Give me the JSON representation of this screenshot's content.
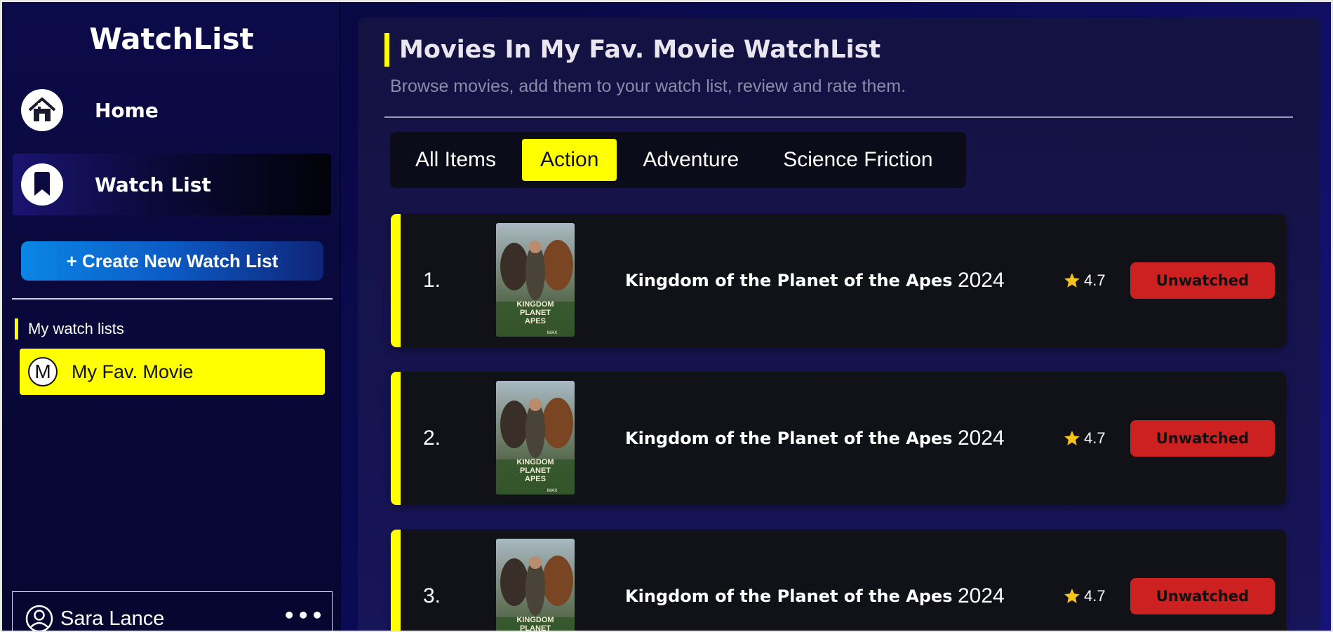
{
  "sidebar": {
    "brand": "WatchList",
    "nav": [
      {
        "label": "Home",
        "icon": "home-icon"
      },
      {
        "label": "Watch List",
        "icon": "bookmark-icon"
      }
    ],
    "create_button": "+ Create New Watch List",
    "section_label": "My watch lists",
    "lists": [
      {
        "avatar": "M",
        "label": "My Fav. Movie"
      }
    ],
    "user": {
      "name": "Sara Lance",
      "icon": "user-circle-icon",
      "more_icon": "more-horizontal-icon"
    }
  },
  "main": {
    "title": "Movies In My Fav. Movie WatchList",
    "subtitle": "Browse movies, add them to your watch list, review and rate them.",
    "tabs": [
      {
        "label": "All Items"
      },
      {
        "label": "Action",
        "active": true
      },
      {
        "label": "Adventure"
      },
      {
        "label": "Science Friction"
      }
    ],
    "movies": [
      {
        "rank": "1.",
        "title": "Kingdom of the Planet of the Apes",
        "year": "2024",
        "rating": "4.7",
        "status": "Unwatched"
      },
      {
        "rank": "2.",
        "title": "Kingdom of the Planet of the Apes",
        "year": "2024",
        "rating": "4.7",
        "status": "Unwatched"
      },
      {
        "rank": "3.",
        "title": "Kingdom of the Planet of the Apes",
        "year": "2024",
        "rating": "4.7",
        "status": "Unwatched"
      }
    ],
    "poster_text": [
      "KINGDOM",
      "PLANET",
      "APES",
      "IMAX"
    ]
  },
  "colors": {
    "accent": "#ffff00",
    "status_unwatched": "#cd2020",
    "star": "#f5c518",
    "background": "#0b0b55"
  }
}
